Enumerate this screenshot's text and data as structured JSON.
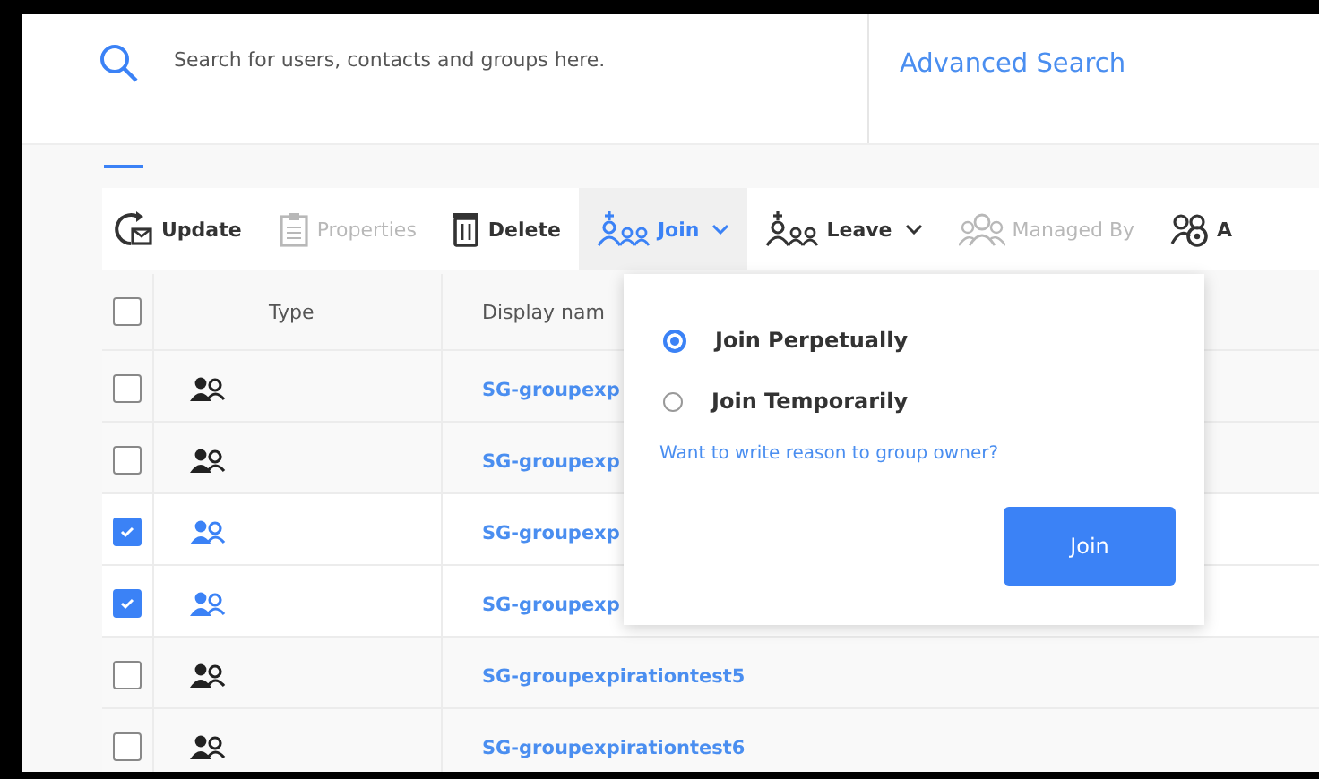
{
  "search": {
    "placeholder": "Search for users, contacts and groups here.",
    "advanced_link": "Advanced Search"
  },
  "toolbar": [
    {
      "label": "Update",
      "kind": "update",
      "disabled": false,
      "active": false,
      "has_menu": false
    },
    {
      "label": "Properties",
      "kind": "properties",
      "disabled": true,
      "active": false,
      "has_menu": false
    },
    {
      "label": "Delete",
      "kind": "delete",
      "disabled": false,
      "active": false,
      "has_menu": false
    },
    {
      "label": "Join",
      "kind": "join",
      "disabled": false,
      "active": true,
      "has_menu": true
    },
    {
      "label": "Leave",
      "kind": "leave",
      "disabled": false,
      "active": false,
      "has_menu": true
    },
    {
      "label": "Managed By",
      "kind": "managed",
      "disabled": true,
      "active": false,
      "has_menu": false
    },
    {
      "label": "A",
      "kind": "settings",
      "disabled": false,
      "active": false,
      "has_menu": false
    }
  ],
  "table": {
    "header_checked": false,
    "columns": [
      "Type",
      "Display nam"
    ],
    "rows": [
      {
        "selected": false,
        "name": "SG-groupexp"
      },
      {
        "selected": false,
        "name": "SG-groupexp"
      },
      {
        "selected": true,
        "name": "SG-groupexp"
      },
      {
        "selected": true,
        "name": "SG-groupexp"
      },
      {
        "selected": false,
        "name": "SG-groupexpirationtest5"
      },
      {
        "selected": false,
        "name": "SG-groupexpirationtest6"
      }
    ]
  },
  "join_menu": {
    "options": [
      {
        "label": "Join Perpetually",
        "selected": true
      },
      {
        "label": "Join Temporarily",
        "selected": false
      }
    ],
    "reason_link": "Want to write reason to group owner?",
    "button": "Join"
  }
}
